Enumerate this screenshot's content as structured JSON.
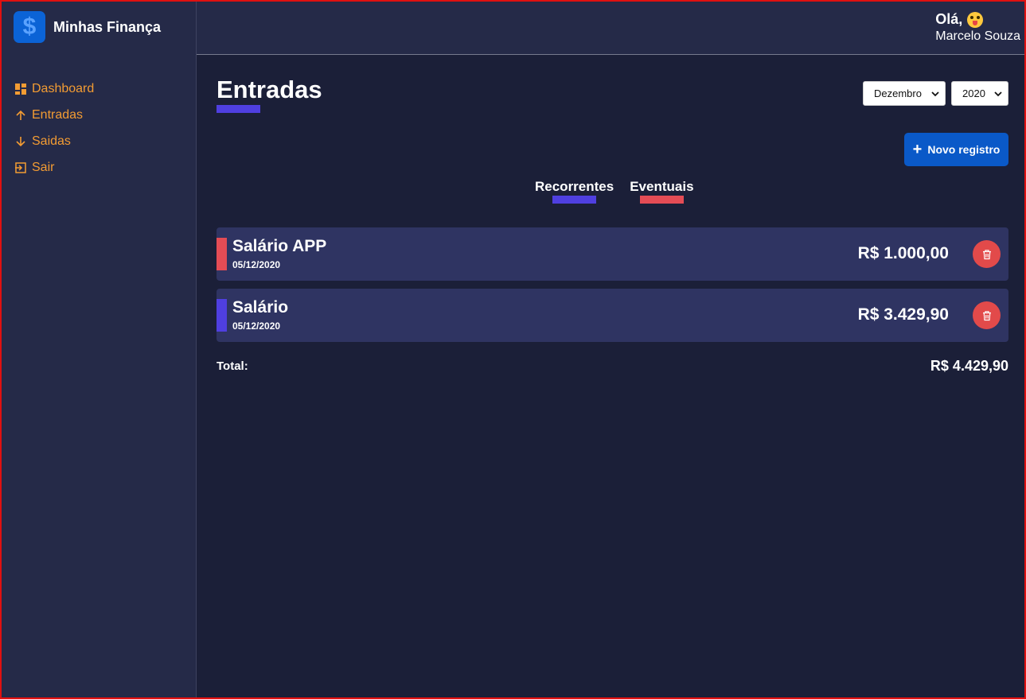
{
  "app": {
    "name": "Minhas Finança",
    "logo_symbol": "$"
  },
  "sidebar": {
    "items": [
      {
        "label": "Dashboard",
        "icon": "dashboard-icon"
      },
      {
        "label": "Entradas",
        "icon": "arrow-up-icon"
      },
      {
        "label": "Saidas",
        "icon": "arrow-down-icon"
      },
      {
        "label": "Sair",
        "icon": "logout-icon"
      }
    ],
    "color": "#f39c33"
  },
  "header": {
    "greeting": "Olá,",
    "emoji": "face-with-tongue-icon",
    "user_name": "Marcelo Souza"
  },
  "page": {
    "title": "Entradas",
    "month_select": {
      "selected": "Dezembro"
    },
    "year_select": {
      "selected": "2020"
    },
    "new_button": "Novo registro"
  },
  "filters": [
    {
      "label": "Recorrentes",
      "color": "#4f3fe0"
    },
    {
      "label": "Eventuais",
      "color": "#e44c55"
    }
  ],
  "entries": [
    {
      "title": "Salário APP",
      "date": "05/12/2020",
      "amount": "R$ 1.000,00",
      "tag_color": "#e44c55"
    },
    {
      "title": "Salário",
      "date": "05/12/2020",
      "amount": "R$ 3.429,90",
      "tag_color": "#4f3fe0"
    }
  ],
  "total": {
    "label": "Total:",
    "value": "R$ 4.429,90"
  },
  "colors": {
    "background": "#1b1f38",
    "panel": "#252a48",
    "card": "#2f3462",
    "accent": "#0a59c8",
    "delete": "#e24a4a"
  }
}
